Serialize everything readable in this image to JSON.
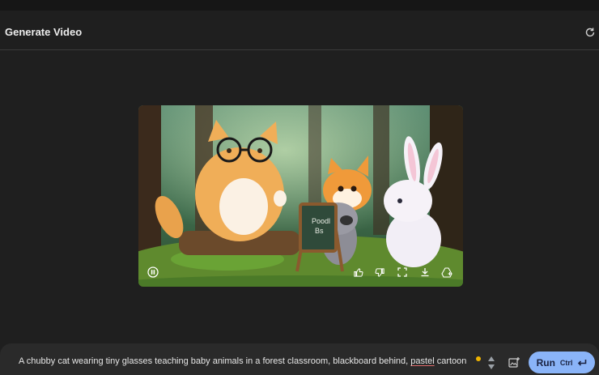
{
  "header": {
    "title": "Generate Video"
  },
  "icons": {
    "refresh": "refresh-icon",
    "pause": "pause-icon",
    "thumbs_up": "thumbs-up-icon",
    "thumbs_down": "thumbs-down-icon",
    "fullscreen": "fullscreen-icon",
    "download": "download-icon",
    "drive": "drive-add-icon",
    "add_image": "add-image-icon",
    "stepper": "up-down-icon",
    "enter": "enter-icon"
  },
  "video": {
    "board_text_line1": "Poodl",
    "board_text_line2": "Bs"
  },
  "prompt": {
    "before": "A chubby cat wearing tiny glasses teaching baby animals in a forest classroom, blackboard behind, ",
    "misspelled": "pastel",
    "after": " cartoon"
  },
  "run_button": {
    "label": "Run",
    "shortcut": "Ctrl"
  },
  "colors": {
    "accent": "#8ab4f8",
    "status_dot": "#f0b400",
    "background": "#1f1f1f"
  }
}
